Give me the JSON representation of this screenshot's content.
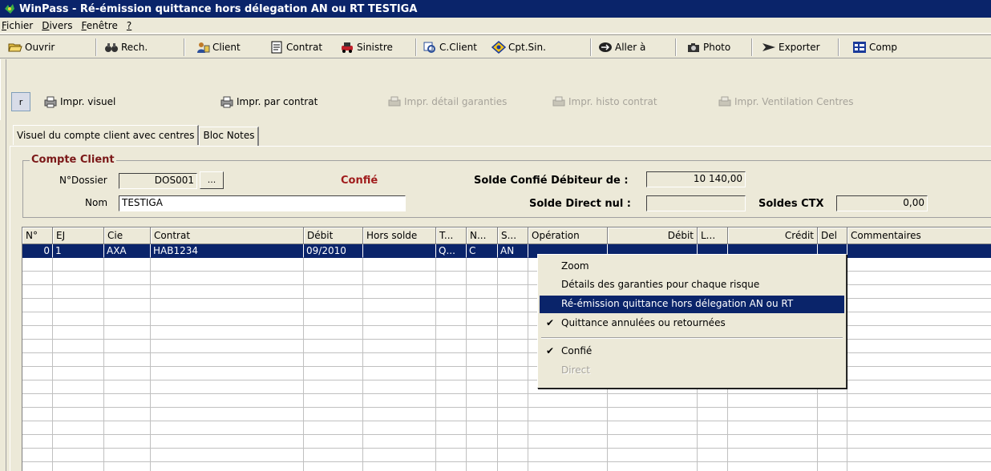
{
  "window": {
    "title": "WinPass - Ré-émission quittance hors délegation AN ou RT TESTIGA"
  },
  "menu": [
    "Fichier",
    "Divers",
    "Fenêtre",
    "?"
  ],
  "toolbar": [
    {
      "label": "Ouvrir",
      "icon": "folder-open-icon"
    },
    {
      "label": "Rech.",
      "icon": "binoculars-icon"
    },
    {
      "label": "Client",
      "icon": "client-icon"
    },
    {
      "label": "Contrat",
      "icon": "contract-icon"
    },
    {
      "label": "Sinistre",
      "icon": "claim-icon"
    },
    {
      "label": "C.Client",
      "icon": "client-account-icon"
    },
    {
      "label": "Cpt.Sin.",
      "icon": "claim-account-icon"
    },
    {
      "label": "Aller à",
      "icon": "goto-icon"
    },
    {
      "label": "Photo",
      "icon": "camera-icon"
    },
    {
      "label": "Exporter",
      "icon": "export-icon"
    },
    {
      "label": "Comp",
      "icon": "compare-icon"
    }
  ],
  "print_toolbar": {
    "r_button": "r",
    "items": [
      {
        "label": "Impr. visuel",
        "enabled": true
      },
      {
        "label": "Impr. par contrat",
        "enabled": true
      },
      {
        "label": "Impr. détail garanties",
        "enabled": false
      },
      {
        "label": "Impr. histo contrat",
        "enabled": false
      },
      {
        "label": "Impr. Ventilation Centres",
        "enabled": false
      }
    ]
  },
  "tabs": [
    "Visuel du compte client avec centres",
    "Bloc Notes"
  ],
  "account": {
    "group_title": "Compte Client",
    "dossier_label": "N°Dossier",
    "dossier_value": "DOS001",
    "dots_button": "...",
    "nom_label": "Nom",
    "nom_value": "TESTIGA",
    "status": "Confié",
    "solde_confie_label": "Solde Confié Débiteur de :",
    "solde_confie_value": "10 140,00",
    "solde_direct_label": "Solde Direct nul :",
    "solde_direct_value": "",
    "soldes_ctx_label": "Soldes CTX",
    "soldes_ctx_value": "0,00"
  },
  "grid": {
    "columns": [
      "N°",
      "EJ",
      "Cie",
      "Contrat",
      "Débit",
      "Hors solde",
      "T...",
      "N...",
      "S...",
      "Opération",
      "Débit",
      "L...",
      "Crédit",
      "Del",
      "Commentaires"
    ],
    "rows": [
      [
        "0",
        "1",
        "AXA",
        "HAB1234",
        "09/2010",
        "",
        "Q...",
        "C",
        "AN",
        "",
        "",
        "",
        "",
        "",
        ""
      ]
    ]
  },
  "context_menu": {
    "items": [
      {
        "label": "Zoom",
        "checked": false,
        "highlighted": false,
        "disabled": false
      },
      {
        "label": "Détails des garanties pour chaque risque",
        "checked": false,
        "highlighted": false,
        "disabled": false
      },
      {
        "label": "Ré-émission quittance hors délegation AN ou RT",
        "checked": false,
        "highlighted": true,
        "disabled": false
      },
      {
        "label": "Quittance annulées ou retournées",
        "checked": true,
        "highlighted": false,
        "disabled": false
      },
      {
        "label": "Confié",
        "checked": true,
        "highlighted": false,
        "disabled": false
      },
      {
        "label": "Direct",
        "checked": false,
        "highlighted": false,
        "disabled": true
      }
    ]
  },
  "colors": {
    "title_bar": "#0a246a",
    "selection": "#0a246a",
    "face": "#ece9d8",
    "label_red": "#a01c1c"
  }
}
